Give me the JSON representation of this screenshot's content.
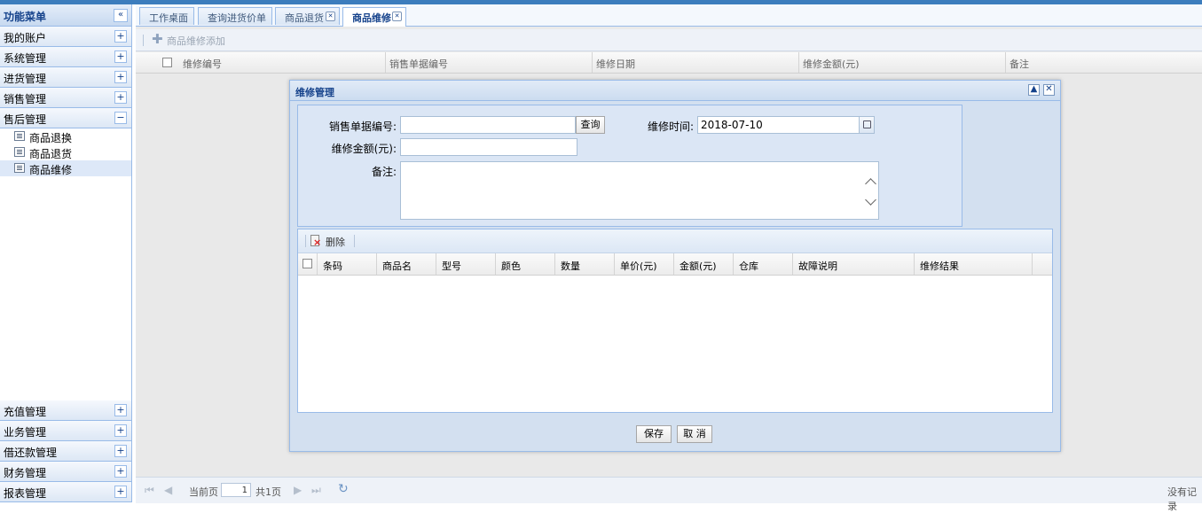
{
  "sidebar": {
    "title": "功能菜单",
    "collapse_glyph": "«",
    "sections_top": [
      {
        "label": "我的账户",
        "toggle": "+"
      },
      {
        "label": "系统管理",
        "toggle": "+"
      },
      {
        "label": "进货管理",
        "toggle": "+"
      },
      {
        "label": "销售管理",
        "toggle": "+"
      },
      {
        "label": "售后管理",
        "toggle": "−"
      }
    ],
    "tree_items": [
      {
        "label": "商品退换",
        "selected": false
      },
      {
        "label": "商品退货",
        "selected": false
      },
      {
        "label": "商品维修",
        "selected": true
      }
    ],
    "sections_bottom": [
      {
        "label": "充值管理",
        "toggle": "+"
      },
      {
        "label": "业务管理",
        "toggle": "+"
      },
      {
        "label": "借还款管理",
        "toggle": "+"
      },
      {
        "label": "财务管理",
        "toggle": "+"
      },
      {
        "label": "报表管理",
        "toggle": "+"
      }
    ]
  },
  "tabs": [
    {
      "label": "工作桌面",
      "closable": false,
      "active": false
    },
    {
      "label": "查询进货价单",
      "closable": false,
      "active": false
    },
    {
      "label": "商品退货",
      "closable": true,
      "active": false
    },
    {
      "label": "商品维修",
      "closable": true,
      "active": true
    }
  ],
  "toolbar": {
    "add_label": "商品维修添加"
  },
  "grid": {
    "columns": [
      "维修编号",
      "销售单据编号",
      "维修日期",
      "维修金额(元)",
      "备注"
    ]
  },
  "pager": {
    "current_label": "当前页",
    "page_value": "1",
    "total_label": "共1页",
    "empty_label": "没有记录"
  },
  "dialog": {
    "title": "维修管理",
    "form": {
      "sale_no_label": "销售单据编号:",
      "sale_no_value": "",
      "query_button": "查询",
      "repair_time_label": "维修时间:",
      "repair_time_value": "2018-07-10",
      "amount_label": "维修金额(元):",
      "amount_value": "",
      "remark_label": "备注:",
      "remark_value": ""
    },
    "items": {
      "delete_label": "删除",
      "columns": [
        "条码",
        "商品名",
        "型号",
        "颜色",
        "数量",
        "单价(元)",
        "金额(元)",
        "仓库",
        "故障说明",
        "维修结果"
      ]
    },
    "save_button": "保存",
    "cancel_button": "取 消"
  }
}
